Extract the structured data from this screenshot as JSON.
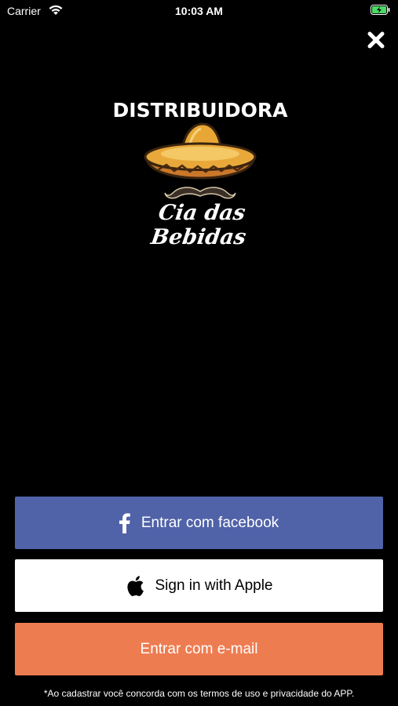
{
  "status_bar": {
    "carrier": "Carrier",
    "time": "10:03 AM",
    "wifi_icon": "wifi-icon",
    "battery_icon": "battery-charging-icon",
    "battery_color": "#4cd964"
  },
  "close_icon": "close-icon",
  "logo": {
    "top_text": "DISTRIBUIDORA",
    "bottom_text": "Cia das Bebidas",
    "image": "sombrero-mustache-logo"
  },
  "buttons": {
    "facebook": {
      "label": "Entrar com facebook",
      "icon": "facebook-icon",
      "color": "#5062a8"
    },
    "apple": {
      "label": "Sign in with Apple",
      "icon": "apple-icon",
      "color": "#ffffff"
    },
    "email": {
      "label": "Entrar com e-mail",
      "color": "#ee7c51"
    }
  },
  "terms_text": "*Ao cadastrar você concorda com os termos de uso e privacidade do APP."
}
